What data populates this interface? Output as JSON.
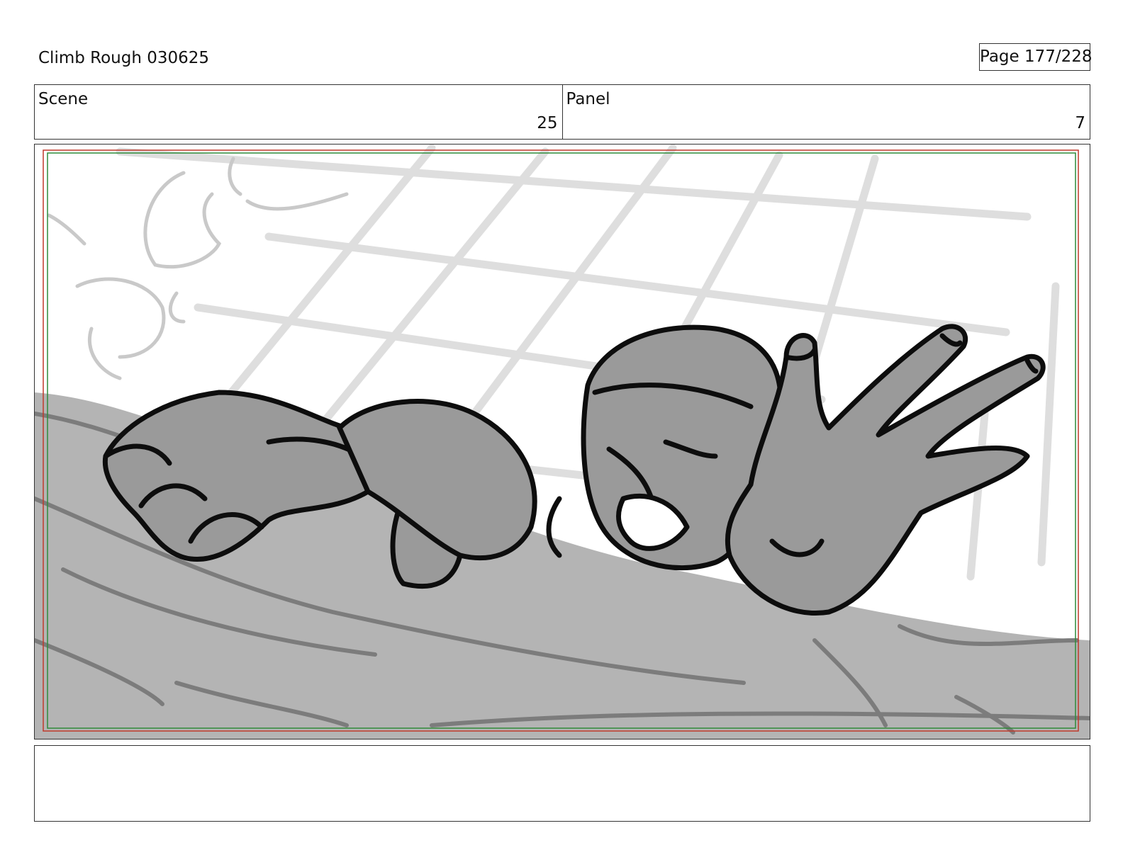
{
  "header": {
    "title": "Climb Rough 030625",
    "page": "Page 177/228"
  },
  "info": {
    "scene_label": "Scene",
    "scene_value": "25",
    "panel_label": "Panel",
    "panel_value": "7"
  },
  "artwork": {
    "description_icon": "storyboard-sketch",
    "fill_gray": "#9a9a9a",
    "ground_gray": "#b4b4b4",
    "grid_gray": "#dedede",
    "ink": "#0d0d0d",
    "safe_line_red": "#c0392b",
    "safe_line_green": "#2e8b3a"
  },
  "notes": {
    "text": ""
  }
}
